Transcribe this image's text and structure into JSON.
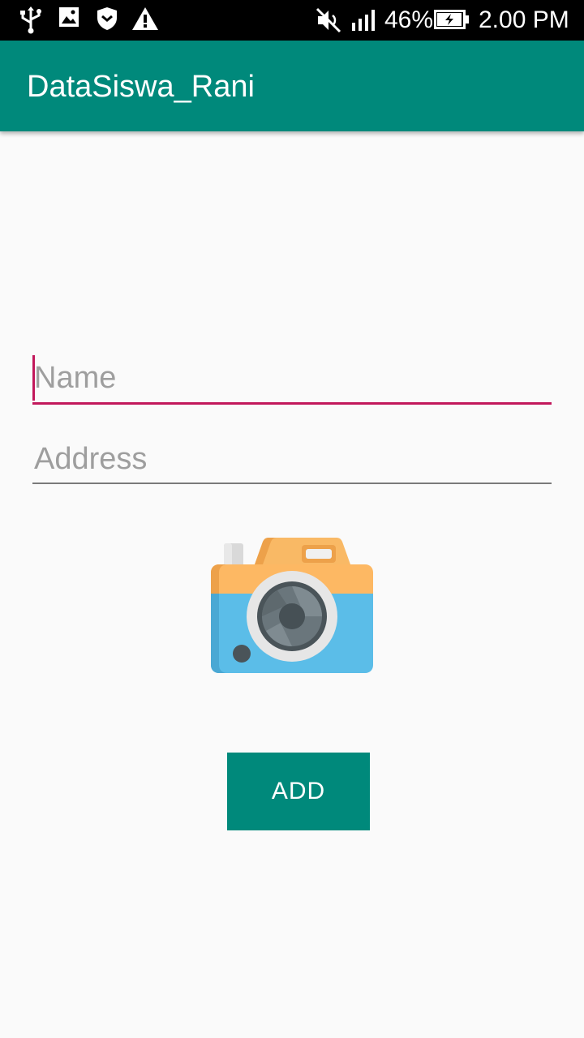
{
  "status_bar": {
    "battery": "46%",
    "time": "2.00 PM",
    "icons": [
      "usb-icon",
      "image-icon",
      "shield-icon",
      "warning-icon",
      "mute-icon",
      "signal-icon",
      "battery-charging-icon"
    ]
  },
  "app_bar": {
    "title": "DataSiswa_Rani",
    "color": "#00897b"
  },
  "form": {
    "name": {
      "placeholder": "Name",
      "value": ""
    },
    "address": {
      "placeholder": "Address",
      "value": ""
    },
    "camera_icon": "camera-icon",
    "add_label": "ADD"
  },
  "colors": {
    "primary": "#00897b",
    "accent": "#c2185b"
  }
}
